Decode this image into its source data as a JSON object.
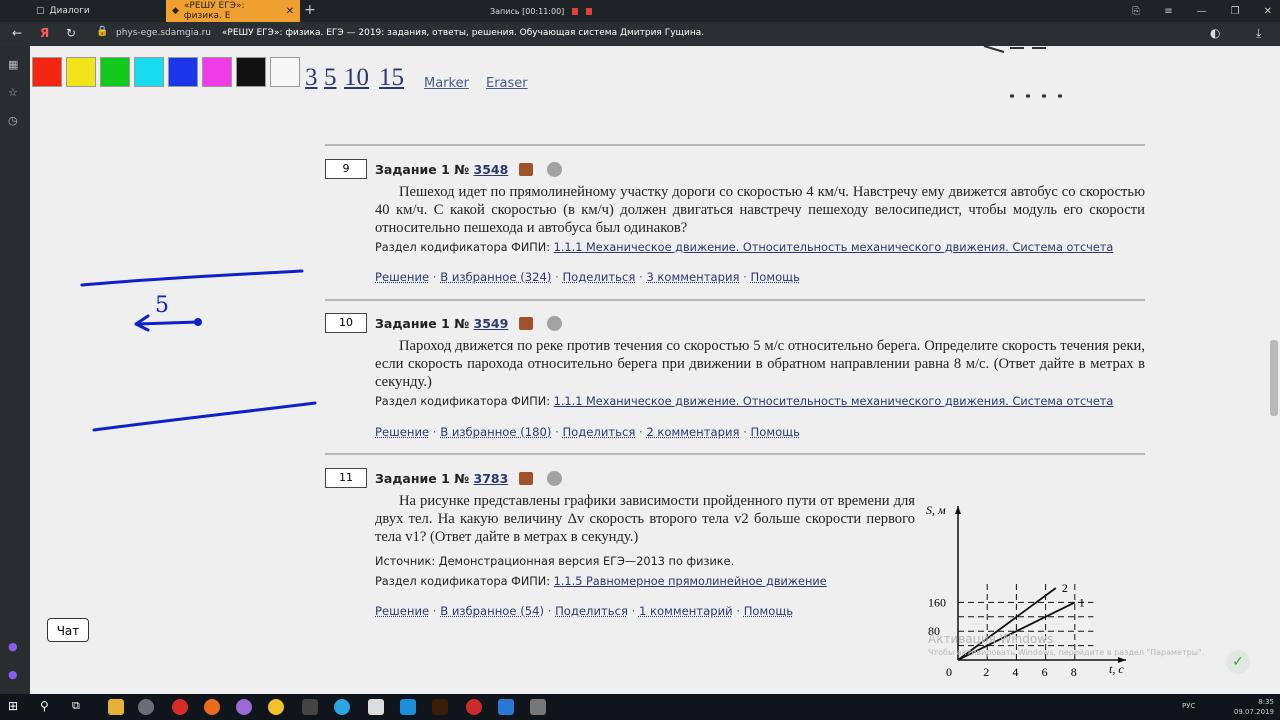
{
  "browser": {
    "tabs": [
      {
        "title": "Диалоги"
      },
      {
        "title": "«РЕШУ ЕГЭ»: физика. Е"
      }
    ],
    "recording": "Запись [00:11:00]",
    "address_host": "phys-ege.sdamgia.ru",
    "address_title": "«РЕШУ ЕГЭ»: физика. ЕГЭ — 2019: задания, ответы, решения. Обучающая система Дмитрия Гущина."
  },
  "toolbar": {
    "colors": [
      "#f22613",
      "#f1e31c",
      "#12c81c",
      "#17dcef",
      "#1b36e8",
      "#ee3ce8",
      "#111111",
      "#f7f7f7"
    ],
    "sizes": [
      "3",
      "5",
      "10",
      "15"
    ],
    "marker_label": "Marker",
    "eraser_label": "Eraser"
  },
  "problems": [
    {
      "num": "9",
      "label": "Задание 1 №",
      "id": "3548",
      "text": "Пешеход идет по прямолинейному участку дороги со скоростью 4 км/ч. Навстречу ему движется автобус со скоростью 40 км/ч. С какой скоростью (в км/ч) должен двигаться навстречу пешеходу велосипедист, чтобы модуль его скорости относительно пешехода и автобуса был одинаков?",
      "codifier_label": "Раздел кодификатора ФИПИ:",
      "codifier": "1.1.1 Механическое движение. Относительность механического движения. Система отсчета",
      "actions": {
        "solution": "Решение",
        "favorites": "В избранное (324)",
        "share": "Поделиться",
        "comments": "3 комментария",
        "help": "Помощь"
      }
    },
    {
      "num": "10",
      "label": "Задание 1 №",
      "id": "3549",
      "text": "Пароход движется по реке против течения со скоростью 5 м/с относительно берега. Определите скорость течения реки, если скорость парохода относительно берега при движении в обратном направлении равна 8 м/с. (Ответ дайте в метрах в секунду.)",
      "codifier_label": "Раздел кодификатора ФИПИ:",
      "codifier": "1.1.1 Механическое движение. Относительность механического движения. Система отсчета",
      "actions": {
        "solution": "Решение",
        "favorites": "В избранное (180)",
        "share": "Поделиться",
        "comments": "2 комментария",
        "help": "Помощь"
      }
    },
    {
      "num": "11",
      "label": "Задание 1 №",
      "id": "3783",
      "text": "На рисунке представлены графики зависимости пройденного пути от времени для двух тел. На какую величину Δv скорость второго тела v2 больше скорости первого тела v1? (Ответ дайте в метрах в секунду.)",
      "source": "Источник: Демонстрационная версия ЕГЭ—2013 по физике.",
      "codifier_label": "Раздел кодификатора ФИПИ:",
      "codifier": "1.1.5 Равномерное прямолинейное движение",
      "actions": {
        "solution": "Решение",
        "favorites": "В избранное (54)",
        "share": "Поделиться",
        "comments": "1 комментарий",
        "help": "Помощь"
      }
    }
  ],
  "graph": {
    "ylabel": "S, м",
    "xlabel": "t, с",
    "origin": "0",
    "x_ticks": [
      "2",
      "4",
      "6",
      "8"
    ],
    "y_ticks": [
      "80",
      "160"
    ],
    "line1_label": "1",
    "line2_label": "2"
  },
  "chart_data": {
    "type": "line",
    "xlabel": "t, с",
    "ylabel": "S, м",
    "xlim": [
      0,
      9
    ],
    "ylim": [
      0,
      200
    ],
    "x_ticks": [
      2,
      4,
      6,
      8
    ],
    "y_ticks": [
      80,
      160
    ],
    "series": [
      {
        "name": "1",
        "x": [
          0,
          8
        ],
        "y": [
          0,
          160
        ]
      },
      {
        "name": "2",
        "x": [
          0,
          6.7
        ],
        "y": [
          0,
          200
        ]
      }
    ],
    "grid": true
  },
  "annotation_digit": "5",
  "chat_label": "Чат",
  "watermark": {
    "title": "Активация Windows",
    "text": "Чтобы активировать Windows, перейдите в раздел \"Параметры\"."
  },
  "taskbar": {
    "lang": "РУС",
    "time": "8:35",
    "date": "09.07.2019"
  }
}
